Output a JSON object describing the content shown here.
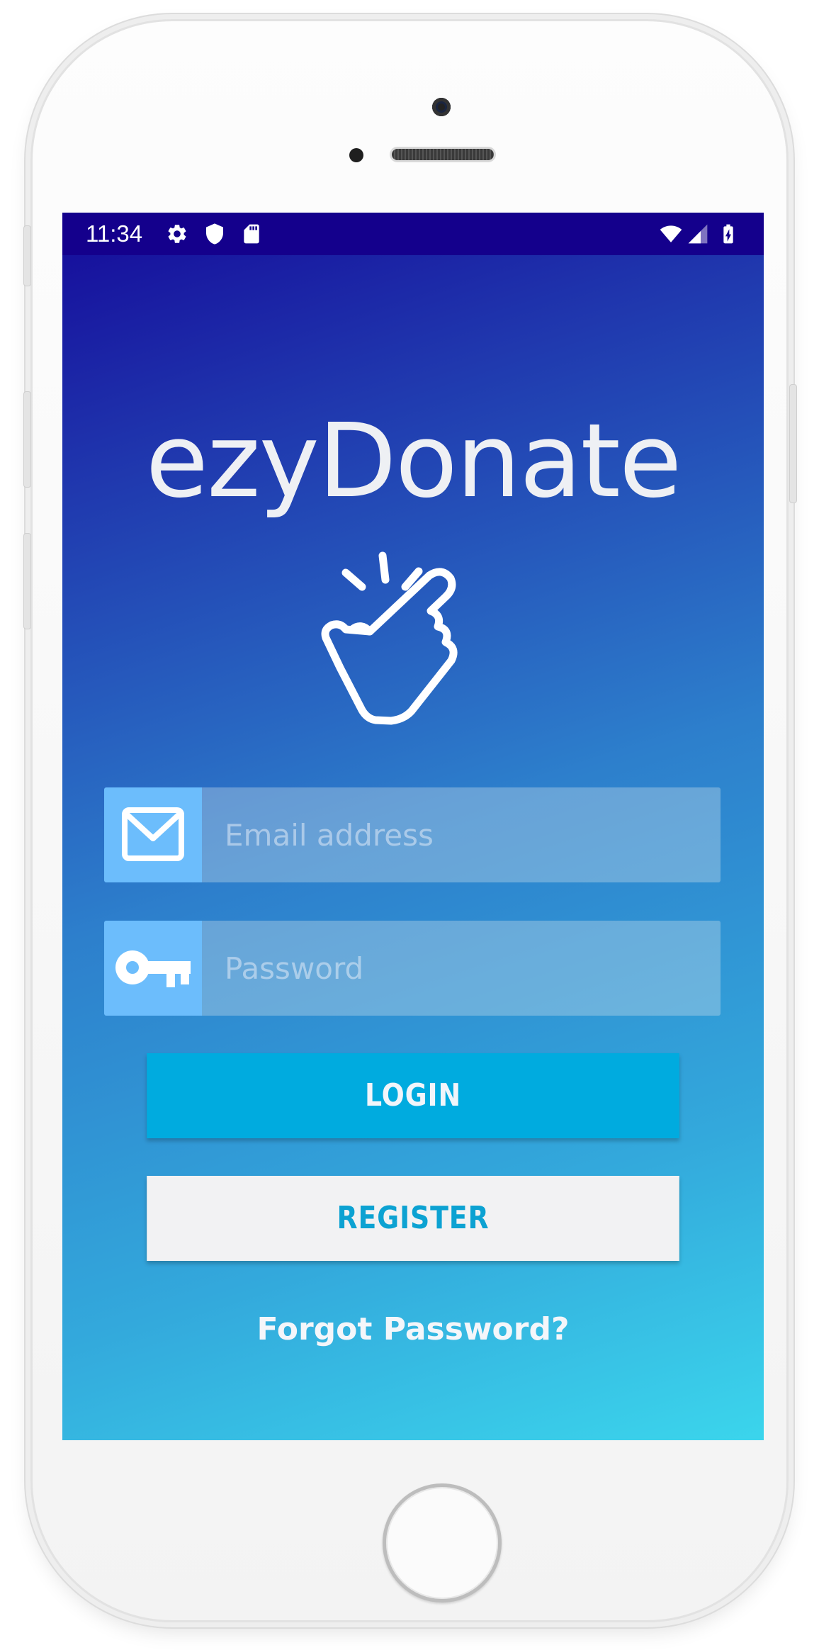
{
  "status_bar": {
    "time": "11:34",
    "left_icons": [
      "settings-icon",
      "shield-icon",
      "sd-card-icon"
    ],
    "right_icons": [
      "wifi-icon",
      "cellular-signal-icon",
      "battery-charging-icon"
    ],
    "background": "#14008c"
  },
  "app": {
    "title": "ezyDonate",
    "logo_icon": "snap-finger-hand-icon"
  },
  "login_form": {
    "email": {
      "icon": "mail-icon",
      "value": "",
      "placeholder": "Email address"
    },
    "password": {
      "icon": "key-icon",
      "value": "",
      "placeholder": "Password"
    },
    "login_label": "LOGIN",
    "register_label": "REGISTER",
    "forgot_password_label": "Forgot Password?"
  },
  "colors": {
    "gradient_start": "#150a9a",
    "gradient_end": "#3bd5ec",
    "login_button": "#00abdf",
    "register_button": "#f2f2f3",
    "register_text": "#0ca2d2",
    "icon_box": "#6cbdfc"
  }
}
